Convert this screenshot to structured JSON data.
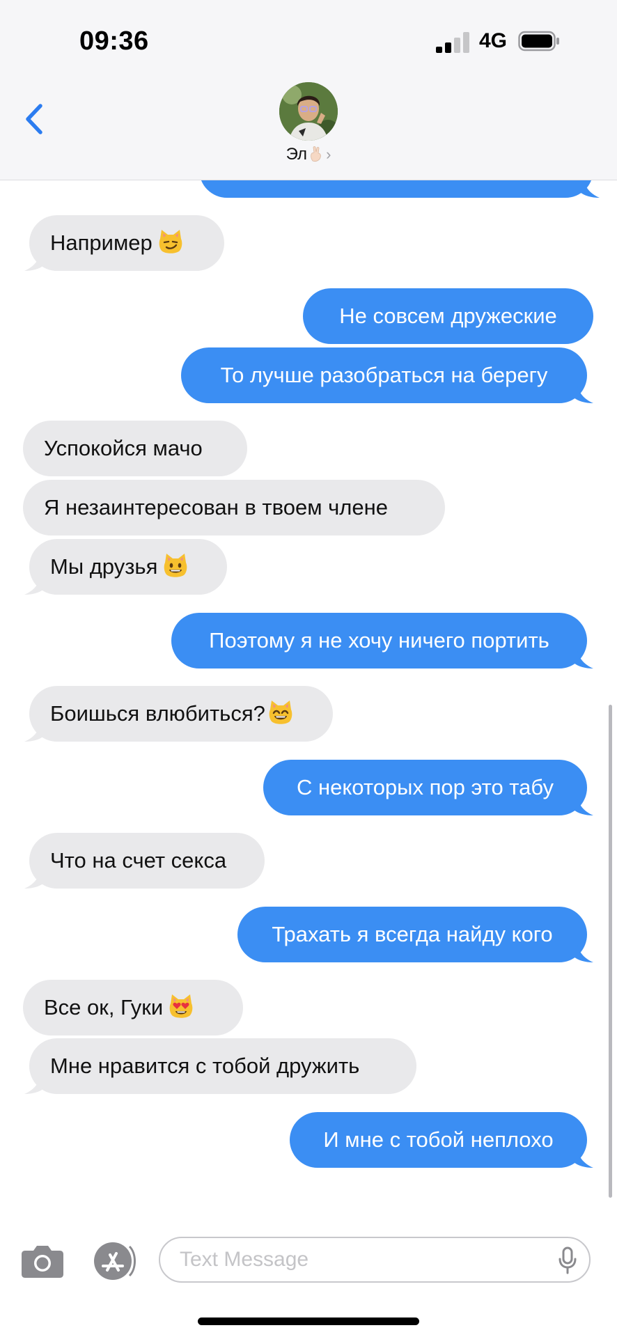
{
  "status_bar": {
    "time": "09:36",
    "network": "4G",
    "signal_bars": 2,
    "signal_bars_total": 4,
    "battery_level": 0.9
  },
  "header": {
    "back_icon": "chevron-left-icon",
    "contact_name": "Эл",
    "contact_name_emoji": "🤞🏻",
    "contact_chevron": "›"
  },
  "messages": [
    {
      "from": "me",
      "text": ""
    },
    {
      "from": "contact",
      "text": "Например",
      "emoji": "smirking-cat"
    },
    {
      "from": "me",
      "text": "Не совсем дружеские"
    },
    {
      "from": "me",
      "text": "То лучше разобраться на берегу"
    },
    {
      "from": "contact",
      "text": "Успокойся мачо"
    },
    {
      "from": "contact",
      "text": "Я незаинтересован в твоем члене"
    },
    {
      "from": "contact",
      "text": "Мы друзья",
      "emoji": "grinning-cat"
    },
    {
      "from": "me",
      "text": "Поэтому я не хочу ничего портить"
    },
    {
      "from": "contact",
      "text": "Боишься влюбиться?",
      "emoji": "grinning-cat-smiling-eyes"
    },
    {
      "from": "me",
      "text": "С некоторых пор это табу"
    },
    {
      "from": "contact",
      "text": "Что на счет секса"
    },
    {
      "from": "me",
      "text": "Трахать я всегда найду кого"
    },
    {
      "from": "contact",
      "text": "Все ок, Гуки",
      "emoji": "heart-eyes-cat"
    },
    {
      "from": "contact",
      "text": "Мне нравится с тобой дружить"
    },
    {
      "from": "me",
      "text": "И мне с тобой неплохо"
    }
  ],
  "input_bar": {
    "camera_icon": "camera-icon",
    "apps_icon": "app-store-icon",
    "placeholder": "Text Message",
    "value": "",
    "mic_icon": "microphone-icon"
  },
  "colors": {
    "outgoing_bubble": "#3b8ef3",
    "incoming_bubble": "#e9e9eb",
    "accent": "#3b8ef3",
    "header_bg": "#f6f6f8"
  }
}
